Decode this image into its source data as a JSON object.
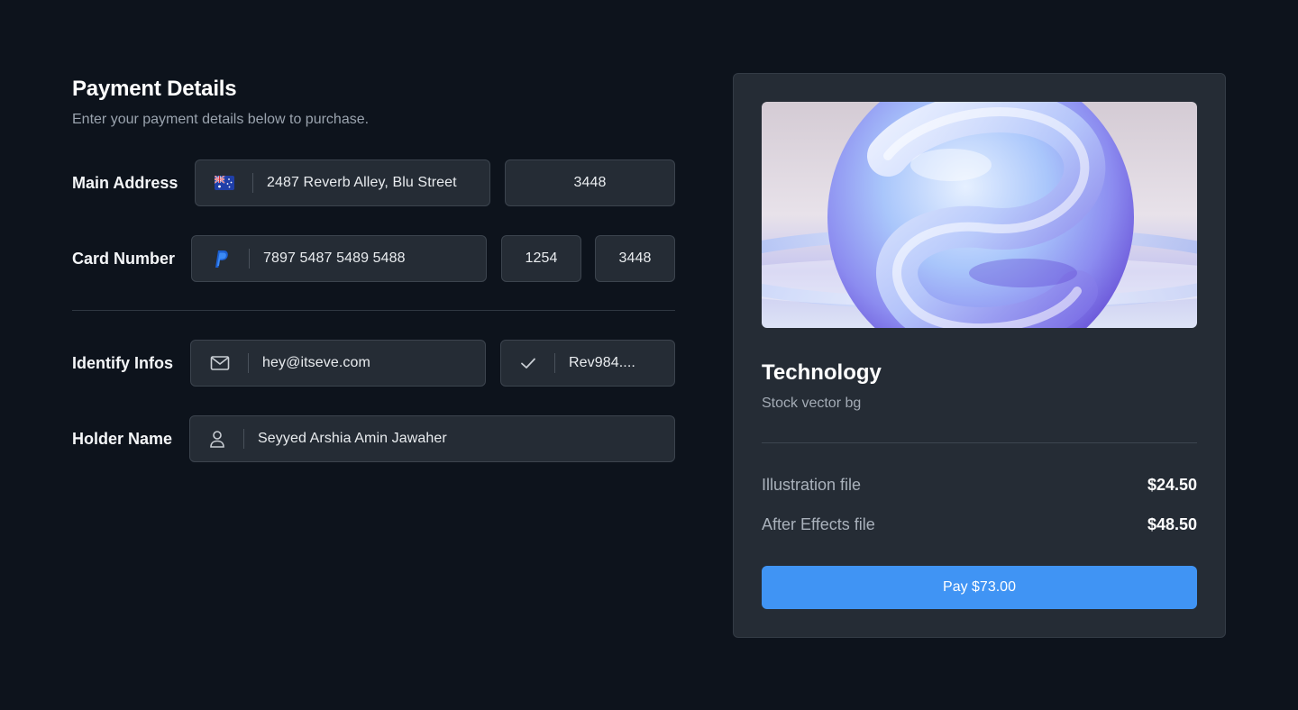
{
  "header": {
    "title": "Payment Details",
    "subtitle": "Enter your payment details below to purchase."
  },
  "form": {
    "main_address": {
      "label": "Main Address",
      "flag_icon": "australia-flag-icon",
      "street": "2487 Reverb Alley, Blu Street",
      "postcode": "3448"
    },
    "card_number": {
      "label": "Card Number",
      "icon": "paypal-icon",
      "number": "7897 5487 5489 5488",
      "expiry": "1254",
      "cvc": "3448"
    },
    "identify_infos": {
      "label": "Identify Infos",
      "email_icon": "mail-icon",
      "email": "hey@itseve.com",
      "check_icon": "check-icon",
      "code": "Rev984...."
    },
    "holder_name": {
      "label": "Holder Name",
      "icon": "user-icon",
      "name": "Seyyed Arshia Amin Jawaher"
    }
  },
  "summary": {
    "title": "Technology",
    "subtitle": "Stock vector bg",
    "items": [
      {
        "label": "Illustration file",
        "price": "$24.50"
      },
      {
        "label": "After Effects file",
        "price": "$48.50"
      }
    ],
    "pay_label": "Pay $73.00"
  },
  "colors": {
    "background": "#0d131c",
    "panel": "#252c35",
    "accent": "#4094f4"
  }
}
